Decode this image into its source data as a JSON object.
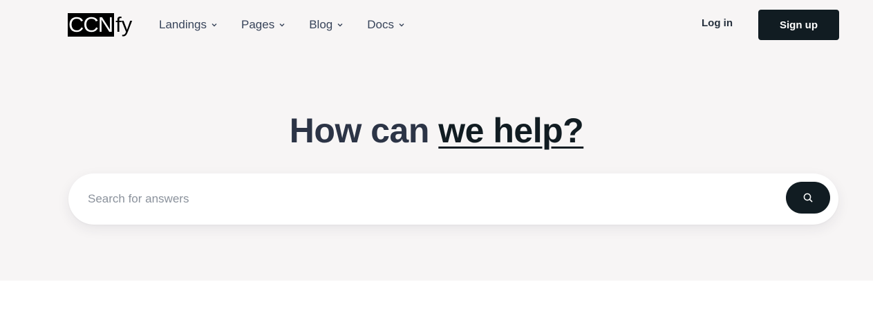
{
  "brand": {
    "logo_box": "CCN",
    "logo_rest": "fy"
  },
  "nav": {
    "items": [
      {
        "label": "Landings",
        "icon": "chevron-down-icon"
      },
      {
        "label": "Pages",
        "icon": "chevron-down-icon"
      },
      {
        "label": "Blog",
        "icon": "chevron-down-icon"
      },
      {
        "label": "Docs",
        "icon": "chevron-down-icon"
      }
    ],
    "login_label": "Log in",
    "signup_label": "Sign up"
  },
  "hero": {
    "headline_plain": "How can ",
    "headline_accent": "we help?"
  },
  "search": {
    "placeholder": "Search for answers",
    "value": "",
    "button_icon": "search-icon"
  },
  "colors": {
    "hero_background": "#f7f5f5",
    "primary_button": "#111c22",
    "headline_text": "#2c3446"
  }
}
